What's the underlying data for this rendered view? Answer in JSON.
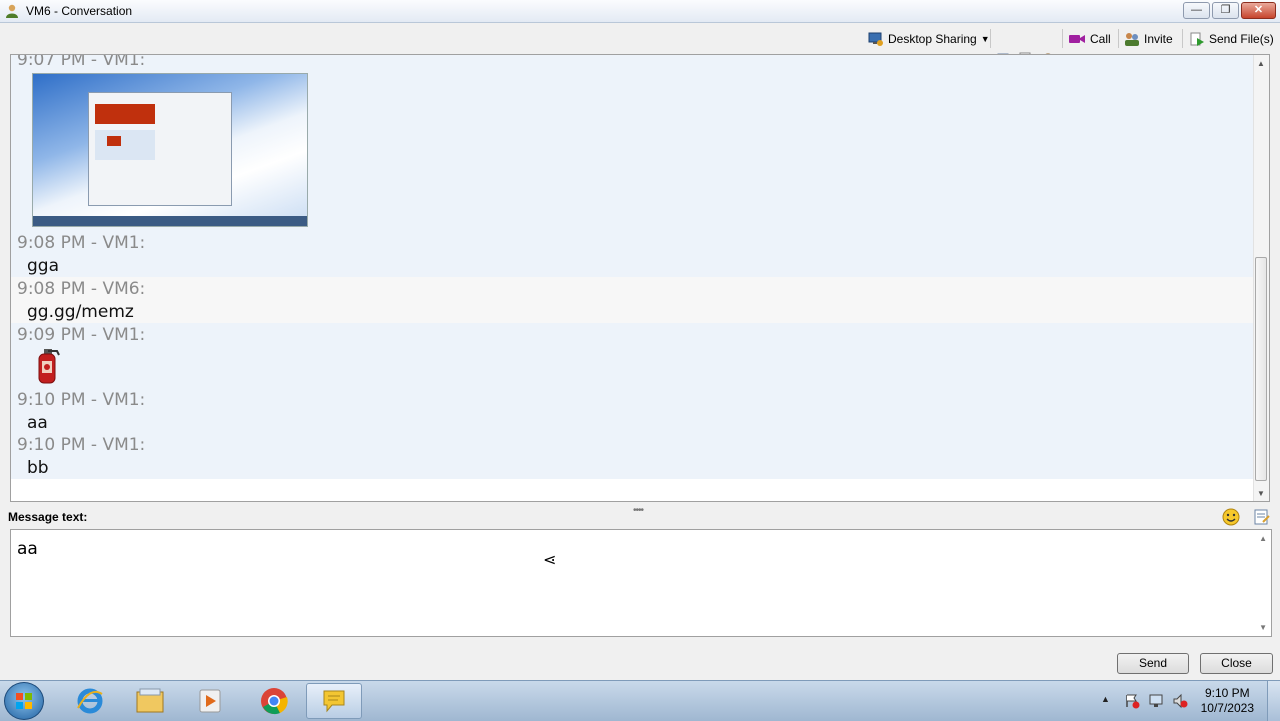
{
  "window": {
    "title": "VM6 - Conversation"
  },
  "toolbar": {
    "desktop_sharing": "Desktop Sharing",
    "call": "Call",
    "invite": "Invite",
    "send_files": "Send File(s)"
  },
  "chat": {
    "messages": [
      {
        "timestamp": "9:07 PM - VM1:",
        "content": ""
      },
      {
        "timestamp": "9:08 PM - VM1:",
        "content": "gga"
      },
      {
        "timestamp": "9:08 PM - VM6:",
        "content": "gg.gg/memz"
      },
      {
        "timestamp": "9:09 PM - VM1:",
        "content": ""
      },
      {
        "timestamp": "9:10 PM - VM1:",
        "content": "aa"
      },
      {
        "timestamp": "9:10 PM - VM1:",
        "content": "bb"
      }
    ]
  },
  "composer": {
    "label": "Message text:",
    "value": "aa"
  },
  "buttons": {
    "send": "Send",
    "close": "Close"
  },
  "taskbar": {
    "time": "9:10 PM",
    "date": "10/7/2023"
  },
  "colors": {
    "band_blue": "#edf3fa",
    "band_light": "#f7f7f7",
    "timestamp": "#8a8a8a",
    "title_bg": "#dfe8f3"
  }
}
